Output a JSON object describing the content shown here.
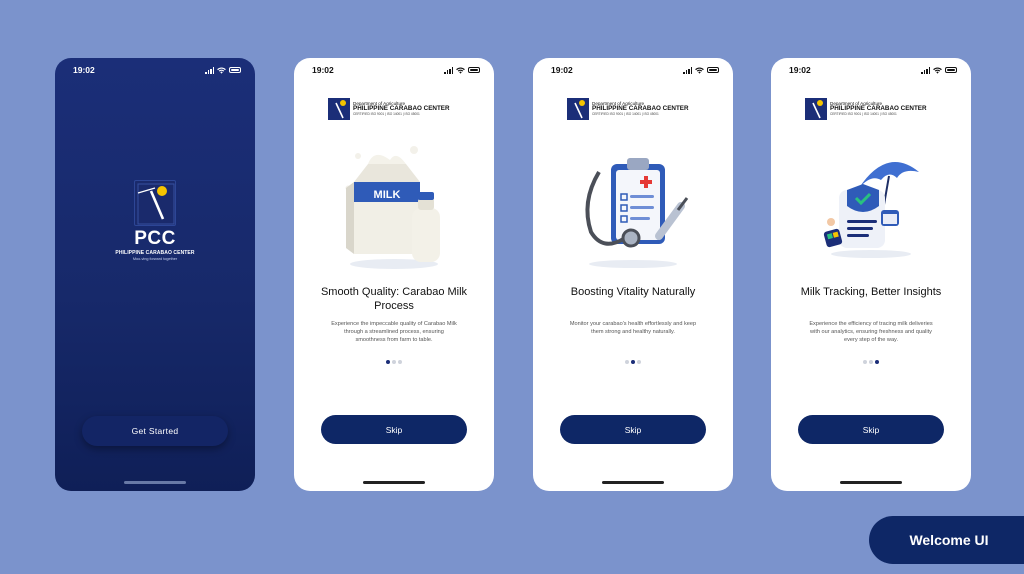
{
  "badge": "Welcome UI",
  "status_time": "19:02",
  "splash": {
    "brand": "PCC",
    "subtitle": "PHILIPPINE CARABAO CENTER",
    "tagline": "Moo-ving forward together",
    "button": "Get Started"
  },
  "org": {
    "dept": "Department of Agriculture",
    "name": "PHILIPPINE CARABAO CENTER",
    "cert": "CERTIFIED ISO 9001 | ISO 14001 | ISO 45001"
  },
  "screens": [
    {
      "title": "Smooth Quality: Carabao Milk Process",
      "description": "Experience the impeccable quality of Carabao Milk through a streamlined process, ensuring smoothness from farm to table.",
      "illustration": "milk-carton-icon",
      "active_dot": 0,
      "button": "Skip"
    },
    {
      "title": "Boosting Vitality Naturally",
      "description": "Monitor your carabao's health effortlessly and keep them strong and healthy naturally.",
      "illustration": "medical-checkup-icon",
      "active_dot": 1,
      "button": "Skip"
    },
    {
      "title": "Milk Tracking, Better Insights",
      "description": "Experience the efficiency of tracing milk deliveries with our analytics, ensuring freshness and quality every step of the way.",
      "illustration": "insurance-tracking-icon",
      "active_dot": 2,
      "button": "Skip"
    }
  ],
  "colors": {
    "background": "#7b93cc",
    "primary": "#0e2766",
    "splash": "#1b2e78",
    "accent_yellow": "#f5c400"
  }
}
